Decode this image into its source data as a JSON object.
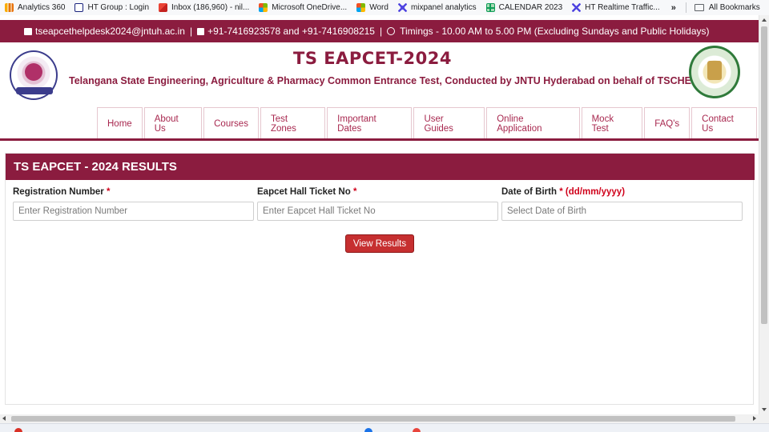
{
  "bookmarks": [
    {
      "label": "Analytics 360",
      "icon": "analytics-icon",
      "color": "#f9ab00"
    },
    {
      "label": "HT Group : Login",
      "icon": "d-square-icon",
      "color": "#1a237e"
    },
    {
      "label": "Inbox (186,960) - nil...",
      "icon": "gmail-icon",
      "color": "#ea4335"
    },
    {
      "label": "Microsoft OneDrive...",
      "icon": "microsoft-icon",
      "color": "#7fba00"
    },
    {
      "label": "Word",
      "icon": "microsoft-icon",
      "color": "#f25022"
    },
    {
      "label": "mixpanel analytics",
      "icon": "mixpanel-icon",
      "color": "#4f44e0"
    },
    {
      "label": "CALENDAR 2023",
      "icon": "sheets-icon",
      "color": "#0f9d58"
    },
    {
      "label": "HT Realtime Traffic...",
      "icon": "mixpanel-icon",
      "color": "#4f44e0"
    }
  ],
  "bookmarks_more": "»",
  "all_bookmarks": "All Bookmarks",
  "topbar": {
    "email": "tseapcethelpdesk2024@jntuh.ac.in",
    "divider": "|",
    "phones": "+91-7416923578 and +91-7416908215",
    "timings": "Timings - 10.00 AM to 5.00 PM (Excluding Sundays and Public Holidays)"
  },
  "header": {
    "title": "TS EAPCET-2024",
    "subtitle": "Telangana State Engineering, Agriculture & Pharmacy Common Entrance Test, Conducted by JNTU Hyderabad on behalf of TSCHE"
  },
  "nav": [
    "Home",
    "About Us",
    "Courses",
    "Test Zones",
    "Important Dates",
    "User Guides",
    "Online Application",
    "Mock Test",
    "FAQ's",
    "Contact Us"
  ],
  "results": {
    "heading": "TS EAPCET - 2024 RESULTS",
    "reg_label": "Registration Number",
    "reg_placeholder": "Enter Registration Number",
    "hall_label": "Eapcet Hall Ticket No",
    "hall_placeholder": "Enter Eapcet Hall Ticket No",
    "dob_label": "Date of Birth",
    "dob_format": "(dd/mm/yyyy)",
    "dob_placeholder": "Select Date of Birth",
    "required_mark": "*",
    "button": "View Results"
  },
  "colors": {
    "brand": "#8b1c3f",
    "button": "#c62f30",
    "nav_text": "#a8284f"
  }
}
